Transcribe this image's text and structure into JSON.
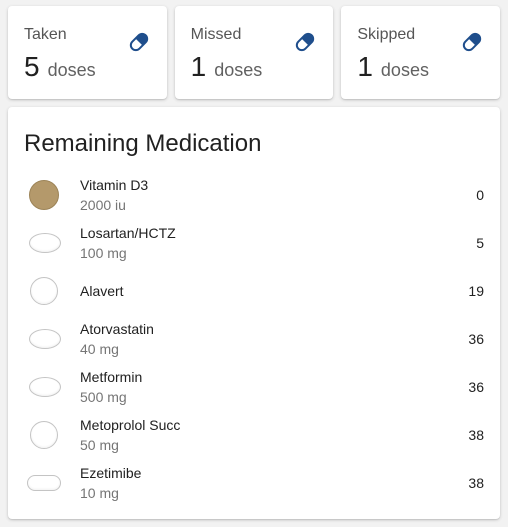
{
  "stats": [
    {
      "title": "Taken",
      "count": "5",
      "unit": "doses",
      "icon": "pill-icon"
    },
    {
      "title": "Missed",
      "count": "1",
      "unit": "doses",
      "icon": "pill-icon"
    },
    {
      "title": "Skipped",
      "count": "1",
      "unit": "doses",
      "icon": "pill-icon"
    }
  ],
  "remaining": {
    "title": "Remaining Medication",
    "items": [
      {
        "name": "Vitamin D3",
        "dose": "2000 iu",
        "count": "0",
        "pill_shape": "round-brown"
      },
      {
        "name": "Losartan/HCTZ",
        "dose": "100 mg",
        "count": "5",
        "pill_shape": "oval-white"
      },
      {
        "name": "Alavert",
        "dose": "",
        "count": "19",
        "pill_shape": "round-white"
      },
      {
        "name": "Atorvastatin",
        "dose": "40 mg",
        "count": "36",
        "pill_shape": "oval-white"
      },
      {
        "name": "Metformin",
        "dose": "500 mg",
        "count": "36",
        "pill_shape": "oval-white"
      },
      {
        "name": "Metoprolol Succ",
        "dose": "50 mg",
        "count": "38",
        "pill_shape": "round-white"
      },
      {
        "name": "Ezetimibe",
        "dose": "10 mg",
        "count": "38",
        "pill_shape": "capsule-white"
      }
    ]
  },
  "colors": {
    "accent": "#1f4e8c",
    "pill_brown": "#b4996b"
  }
}
